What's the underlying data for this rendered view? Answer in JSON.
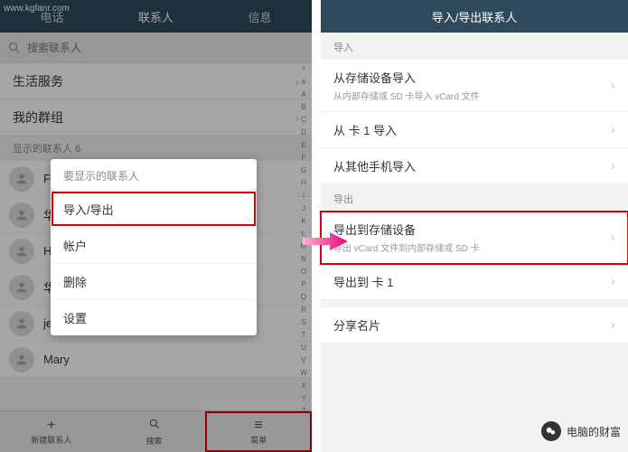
{
  "watermark": "www.kgfanr.com",
  "left": {
    "tabs": [
      "电话",
      "联系人",
      "信息"
    ],
    "search_placeholder": "搜索联系人",
    "sections": [
      "生活服务",
      "我的群组"
    ],
    "count_label": "显示的联系人 6",
    "contacts": [
      "Fg",
      "华",
      "HI",
      "华",
      "je",
      "Mary"
    ],
    "index": [
      "*",
      "#",
      "A",
      "B",
      "C",
      "D",
      "E",
      "F",
      "G",
      "H",
      "I",
      "J",
      "K",
      "L",
      "M",
      "N",
      "O",
      "P",
      "Q",
      "R",
      "S",
      "T",
      "U",
      "V",
      "W",
      "X",
      "Y",
      "Z"
    ],
    "index_active": "F",
    "bottom": [
      {
        "icon": "+",
        "label": "新建联系人"
      },
      {
        "icon": "search",
        "label": "搜索"
      },
      {
        "icon": "menu",
        "label": "菜单"
      }
    ],
    "popup": {
      "title": "要显示的联系人",
      "items": [
        "导入/导出",
        "帐户",
        "删除",
        "设置"
      ],
      "highlight_index": 0
    }
  },
  "right": {
    "title": "导入/导出联系人",
    "import_section": "导入",
    "import_items": [
      {
        "title": "从存储设备导入",
        "sub": "从内部存储或 SD 卡导入 vCard 文件"
      },
      {
        "title": "从 卡 1 导入",
        "sub": ""
      },
      {
        "title": "从其他手机导入",
        "sub": ""
      }
    ],
    "export_section": "导出",
    "export_items": [
      {
        "title": "导出到存储设备",
        "sub": "导出 vCard 文件到内部存储或 SD 卡",
        "highlight": true
      },
      {
        "title": "导出到 卡 1",
        "sub": ""
      }
    ],
    "share_item": {
      "title": "分享名片"
    }
  },
  "wechat_label": "电脑的财富"
}
